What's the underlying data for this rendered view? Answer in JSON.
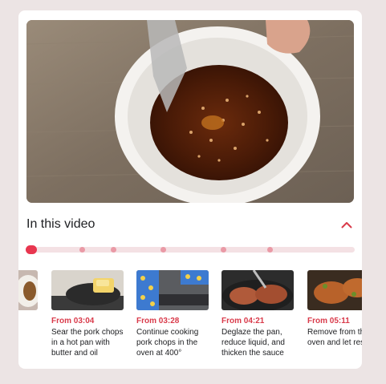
{
  "section": {
    "title": "In this video"
  },
  "colors": {
    "accent": "#e8364f",
    "dot": "#ea9aa6",
    "track": "#f4e1e4"
  },
  "progress": {
    "current_chapter_index": 0,
    "chapter_count": 6
  },
  "chapters": [
    {
      "time": "",
      "description": ""
    },
    {
      "time": "From 03:04",
      "description": "Sear the pork chops\nin a hot pan with\nbutter and oil"
    },
    {
      "time": "From 03:28",
      "description": "Continue cooking\npork chops in the\noven at 400°"
    },
    {
      "time": "From 04:21",
      "description": "Deglaze the pan,\nreduce liquid, and\nthicken the sauce"
    },
    {
      "time": "From 05:11",
      "description": "Remove from th\noven and let res"
    }
  ]
}
